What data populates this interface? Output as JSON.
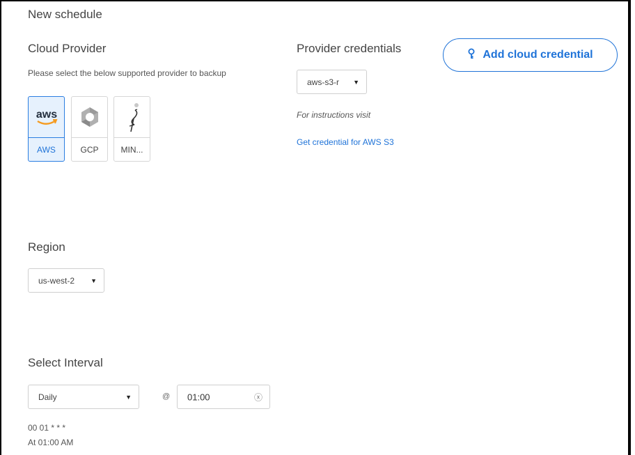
{
  "page": {
    "title": "New schedule"
  },
  "cloud_provider": {
    "heading": "Cloud Provider",
    "helper": "Please select the below supported provider to backup",
    "providers": [
      {
        "label": "AWS",
        "logo_text": "aws",
        "icon": "aws-logo-icon",
        "selected": true
      },
      {
        "label": "GCP",
        "icon": "gcp-hexagon-icon",
        "selected": false
      },
      {
        "label": "MIN...",
        "icon": "minio-flamingo-icon",
        "selected": false
      }
    ]
  },
  "credentials": {
    "heading": "Provider credentials",
    "selected": "aws-s3-r",
    "instructions": "For instructions visit",
    "link": "Get credential for AWS S3"
  },
  "add_credential": {
    "label": "Add cloud credential",
    "icon": "key-icon"
  },
  "region": {
    "heading": "Region",
    "selected": "us-west-2"
  },
  "interval": {
    "heading": "Select Interval",
    "frequency": "Daily",
    "at_symbol": "@",
    "time": "01:00",
    "cron": "00 01 * * *",
    "description": "At 01:00 AM"
  },
  "colors": {
    "accent": "#1f73d8",
    "selected_bg": "#e6f1fd",
    "border": "#cfcfcf",
    "aws_orange": "#f59b20"
  }
}
